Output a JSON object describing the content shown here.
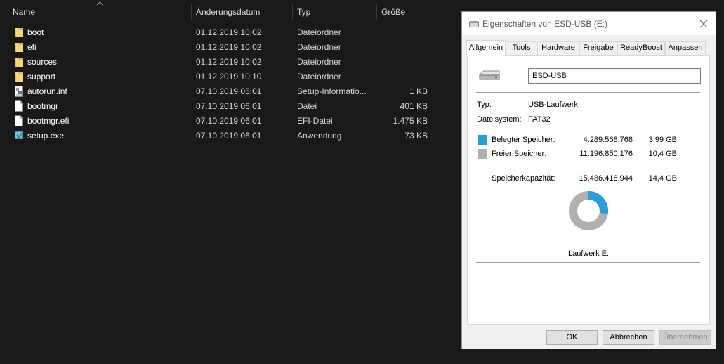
{
  "explorer": {
    "columns": {
      "name": "Name",
      "date": "Änderungsdatum",
      "type": "Typ",
      "size": "Größe"
    },
    "rows": [
      {
        "name": "boot",
        "date": "01.12.2019 10:02",
        "type": "Dateiordner",
        "size": "",
        "icon": "folder-icon"
      },
      {
        "name": "efi",
        "date": "01.12.2019 10:02",
        "type": "Dateiordner",
        "size": "",
        "icon": "folder-icon"
      },
      {
        "name": "sources",
        "date": "01.12.2019 10:02",
        "type": "Dateiordner",
        "size": "",
        "icon": "folder-icon"
      },
      {
        "name": "support",
        "date": "01.12.2019 10:10",
        "type": "Dateiordner",
        "size": "",
        "icon": "folder-icon"
      },
      {
        "name": "autorun.inf",
        "date": "07.10.2019 06:01",
        "type": "Setup-Informatio...",
        "size": "1 KB",
        "icon": "setup-info-file-icon"
      },
      {
        "name": "bootmgr",
        "date": "07.10.2019 06:01",
        "type": "Datei",
        "size": "401 KB",
        "icon": "file-icon"
      },
      {
        "name": "bootmgr.efi",
        "date": "07.10.2019 06:01",
        "type": "EFI-Datei",
        "size": "1.475 KB",
        "icon": "file-icon"
      },
      {
        "name": "setup.exe",
        "date": "07.10.2019 06:01",
        "type": "Anwendung",
        "size": "73 KB",
        "icon": "setup-exe-icon"
      }
    ]
  },
  "dialog": {
    "title": "Eigenschaften von ESD-USB (E:)",
    "tabs": [
      "Allgemein",
      "Tools",
      "Hardware",
      "Freigabe",
      "ReadyBoost",
      "Anpassen"
    ],
    "active_tab": "Allgemein",
    "volume_name": "ESD-USB",
    "type_label": "Typ:",
    "type_value": "USB-Laufwerk",
    "fs_label": "Dateisystem:",
    "fs_value": "FAT32",
    "used_label": "Belegter Speicher:",
    "used_bytes": "4.289.568.768",
    "used_gb": "3,99 GB",
    "free_label": "Freier Speicher:",
    "free_bytes": "11.196.850.176",
    "free_gb": "10,4 GB",
    "capacity_label": "Speicherkapazität:",
    "capacity_bytes": "15.486.418.944",
    "capacity_gb": "14,4 GB",
    "drive_caption": "Laufwerk E:",
    "used_fraction": 0.277,
    "colors": {
      "used": "#26a0da",
      "free": "#b0b0b0"
    },
    "buttons": {
      "ok": "OK",
      "cancel": "Abbrechen",
      "apply": "Übernehmen"
    }
  }
}
